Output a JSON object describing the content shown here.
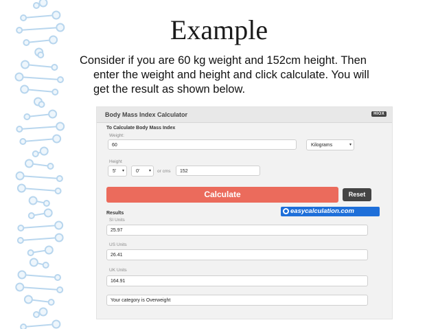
{
  "slide": {
    "title": "Example",
    "paragraph_lines": [
      "Consider if you are 60 kg weight and 152cm height. Then",
      "enter the weight and height and click calculate. You will",
      "get the result as shown below."
    ]
  },
  "calculator": {
    "title": "Body Mass Index Calculator",
    "badge": "HIOX",
    "subtitle": "To Calculate Body Mass Index",
    "weight_label": "Weight:",
    "weight_value": "60",
    "weight_unit": "Kilograms",
    "height_label": "Height",
    "height_feet": "5'",
    "height_inches": "0'",
    "or_cms_label": "or cms",
    "height_cms": "152",
    "calculate_label": "Calculate",
    "reset_label": "Reset",
    "brand_text": "easycalculation.com",
    "results_label": "Results",
    "si_label": "SI Units",
    "si_value": "25.97",
    "us_label": "US Units",
    "us_value": "26.41",
    "uk_label": "UK Units",
    "uk_value": "164.91",
    "category_text": "Your category is Overweight"
  },
  "colors": {
    "calculate_button": "#eb6b5c",
    "reset_button": "#444444",
    "brand_banner": "#1e6fd9",
    "dna_decoration": "#b8d6ee"
  },
  "icons": [
    "dna-strand-decoration",
    "easycalculation-logo-icon",
    "dropdown-arrow-icon"
  ]
}
